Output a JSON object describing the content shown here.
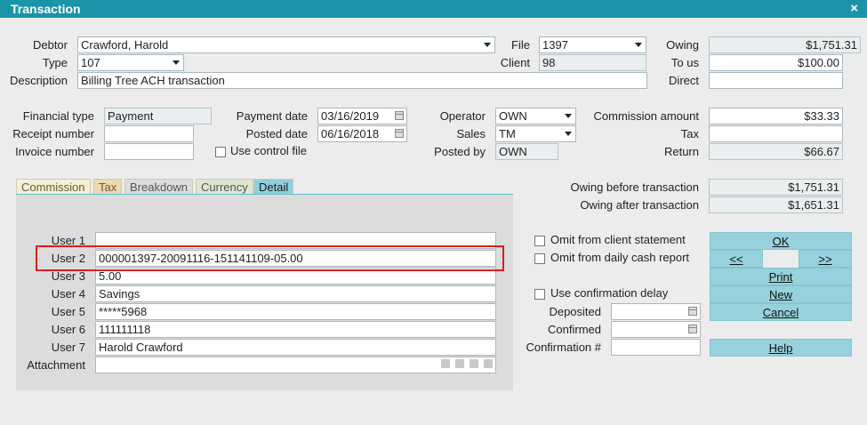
{
  "window": {
    "title": "Transaction",
    "close": "×"
  },
  "debtor": {
    "label": "Debtor",
    "value": "Crawford, Harold"
  },
  "type": {
    "label": "Type",
    "value": "107"
  },
  "description": {
    "label": "Description",
    "value": "Billing Tree ACH transaction"
  },
  "file": {
    "label": "File",
    "value": "1397"
  },
  "client": {
    "label": "Client",
    "value": "98"
  },
  "owing": {
    "label": "Owing",
    "value": "$1,751.31"
  },
  "to_us": {
    "label": "To us",
    "value": "$100.00"
  },
  "direct": {
    "label": "Direct",
    "value": ""
  },
  "financial_type": {
    "label": "Financial type",
    "value": "Payment"
  },
  "receipt_number": {
    "label": "Receipt number",
    "value": ""
  },
  "invoice_number": {
    "label": "Invoice number",
    "value": ""
  },
  "payment_date": {
    "label": "Payment date",
    "value": "03/16/2019"
  },
  "posted_date": {
    "label": "Posted date",
    "value": "06/16/2018"
  },
  "use_control_file": {
    "label": "Use control file",
    "checked": false
  },
  "operator": {
    "label": "Operator",
    "value": "OWN"
  },
  "sales": {
    "label": "Sales",
    "value": "TM"
  },
  "posted_by": {
    "label": "Posted by",
    "value": "OWN"
  },
  "commission_amount": {
    "label": "Commission amount",
    "value": "$33.33"
  },
  "tax": {
    "label": "Tax",
    "value": ""
  },
  "return": {
    "label": "Return",
    "value": "$66.67"
  },
  "tabs": [
    {
      "label": "Commission",
      "active": false,
      "bg": "#f4efd9",
      "fg": "#6b5a2a"
    },
    {
      "label": "Tax",
      "active": false,
      "bg": "#ead9b2",
      "fg": "#6b5a2a"
    },
    {
      "label": "Breakdown",
      "active": false,
      "bg": "#dcdcdc",
      "fg": "#555555"
    },
    {
      "label": "Currency",
      "active": false,
      "bg": "#dfe6d0",
      "fg": "#555555"
    },
    {
      "label": "Detail",
      "active": true,
      "bg": "#8fd0dc",
      "fg": "#1a1a1a"
    }
  ],
  "user_fields": [
    {
      "label": "User 1",
      "value": ""
    },
    {
      "label": "User 2",
      "value": "000001397-20091116-151141109-05.00"
    },
    {
      "label": "User 3",
      "value": "5.00"
    },
    {
      "label": "User 4",
      "value": "Savings"
    },
    {
      "label": "User 5",
      "value": "*****5968"
    },
    {
      "label": "User 6",
      "value": "111111118"
    },
    {
      "label": "User 7",
      "value": "Harold Crawford"
    }
  ],
  "attachment": {
    "label": "Attachment",
    "value": ""
  },
  "owing_before": {
    "label": "Owing before transaction",
    "value": "$1,751.31"
  },
  "owing_after": {
    "label": "Owing after transaction",
    "value": "$1,651.31"
  },
  "omit_client_statement": {
    "label": "Omit from client statement",
    "checked": false
  },
  "omit_daily_cash": {
    "label": "Omit from daily cash report",
    "checked": false
  },
  "use_confirmation_delay": {
    "label": "Use confirmation delay",
    "checked": false
  },
  "deposited": {
    "label": "Deposited",
    "value": ""
  },
  "confirmed": {
    "label": "Confirmed",
    "value": ""
  },
  "confirmation_no": {
    "label": "Confirmation #",
    "value": ""
  },
  "buttons": {
    "ok": "OK",
    "prev": "<<",
    "next": ">>",
    "print": "Print",
    "new": "New",
    "cancel": "Cancel",
    "help": "Help"
  },
  "colors": {
    "title_bar": "#1b94a9",
    "button": "#96d1dc",
    "highlight": "#e01d1d"
  }
}
